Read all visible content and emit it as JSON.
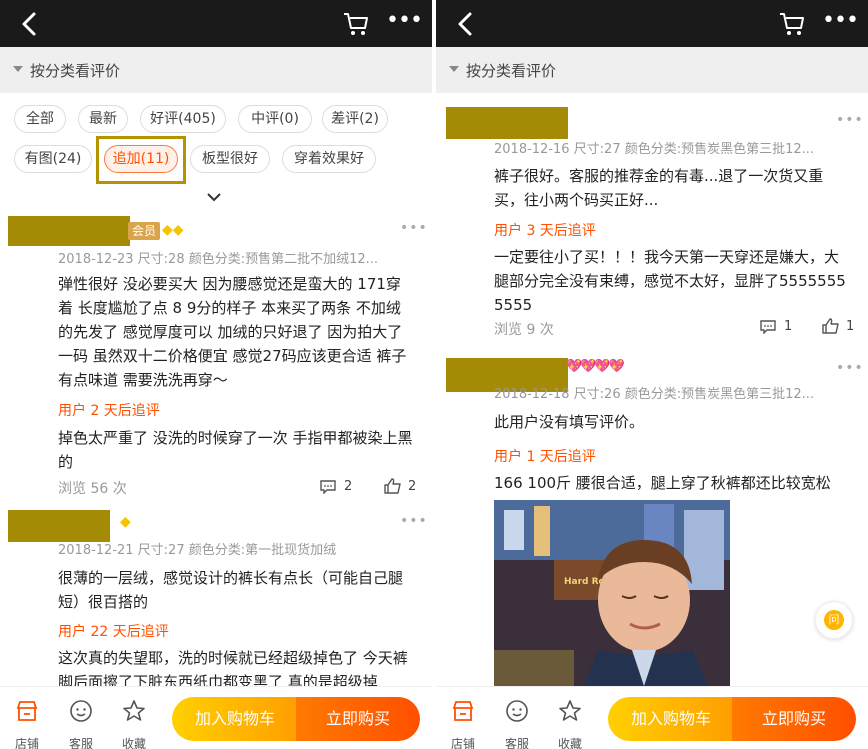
{
  "common": {
    "category_header": "按分类看评价",
    "more_label": "•••",
    "bottom": {
      "shop": "店铺",
      "service": "客服",
      "favorite": "收藏",
      "add_to_cart": "加入购物车",
      "buy_now": "立即购买"
    },
    "colors": {
      "accent": "#ff5000",
      "topbar": "#1a1a1a",
      "redaction": "#a58a05",
      "highlight_box": "#b39400"
    }
  },
  "left": {
    "tags": [
      "全部",
      "最新",
      "好评(405)",
      "中评(0)",
      "差评(2)",
      "有图(24)",
      "追加(11)",
      "板型很好",
      "穿着效果好"
    ],
    "active_tag": "追加(11)",
    "reviews": [
      {
        "badge": "会员",
        "meta": "2018-12-23 尺寸:28 颜色分类:预售第二批不加绒12...",
        "text": "弹性很好 没必要买大 因为腰感觉还是蛮大的 171穿着 长度尴尬了点 8 9分的样子 本来买了两条 不加绒的先发了 感觉厚度可以 加绒的只好退了 因为拍大了一码 虽然双十二价格便宜 感觉27码应该更合适 裤子有点味道 需要洗洗再穿～",
        "followup_label": "用户 2 天后追评",
        "followup_text": "掉色太严重了 没洗的时候穿了一次 手指甲都被染上黑的",
        "views": "浏览 56 次",
        "comments": "2",
        "likes": "2"
      },
      {
        "meta": "2018-12-21 尺寸:27 颜色分类:第一批现货加绒",
        "text": "很薄的一层绒，感觉设计的裤长有点长（可能自己腿短）很百搭的",
        "followup_label": "用户 22 天后追评",
        "followup_text": "这次真的失望耶，洗的时候就已经超级掉色了 今天裤脚后面擦了下脏东西纸巾都变黑了 真的是超级掉"
      }
    ]
  },
  "right": {
    "reviews": [
      {
        "meta": "2018-12-16 尺寸:27 颜色分类:预售炭黑色第三批12...",
        "text": "裤子很好。客服的推荐金的有毒...退了一次货又重买，往小两个码买正好...",
        "followup_label": "用户 3 天后追评",
        "followup_text": "一定要往小了买！！！我今天第一天穿还是嫌大，大腿部分完全没有束缚，感觉不太好，显胖了55555555555",
        "views": "浏览 9 次",
        "comments": "1",
        "likes": "1"
      },
      {
        "meta": "2018-12-18 尺寸:26 颜色分类:预售炭黑色第三批12...",
        "text": "此用户没有填写评价。",
        "followup_label": "用户 1 天后追评",
        "followup_text": "166 100斤 腰很合适，腿上穿了秋裤都还比较宽松",
        "photo_sign": "Hard Rock"
      }
    ],
    "ask_label": "问"
  }
}
